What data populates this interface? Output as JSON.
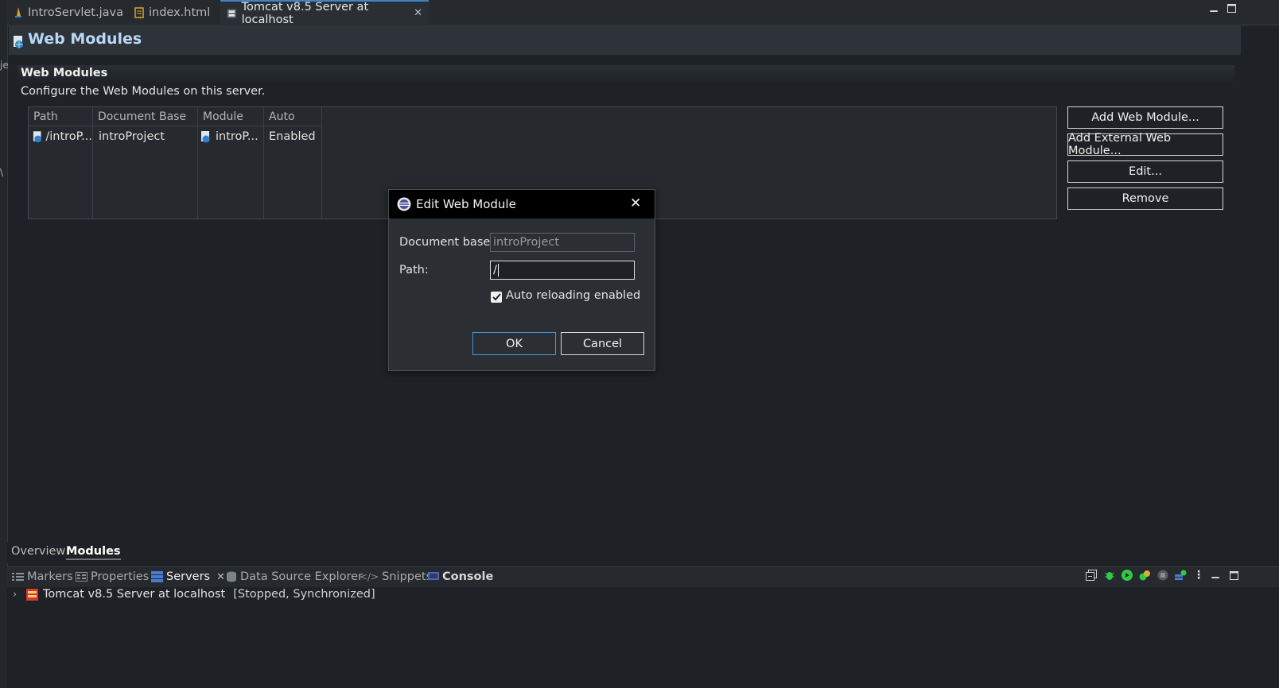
{
  "gutter": {
    "char1": "je",
    "char2": "\\"
  },
  "editor_tabs": [
    {
      "label": "IntroServlet.java",
      "icon": "java-file-icon"
    },
    {
      "label": "index.html",
      "icon": "html-file-icon"
    },
    {
      "label": "Tomcat v8.5 Server at localhost",
      "icon": "server-editor-icon",
      "active": true
    }
  ],
  "form": {
    "title": "Web Modules",
    "section_title": "Web Modules",
    "section_description": "Configure the Web Modules on this server.",
    "table": {
      "columns": [
        "Path",
        "Document Base",
        "Module",
        "Auto Relo"
      ],
      "rows": [
        {
          "path": "/introP...",
          "document_base": "introProject",
          "module": "introP...",
          "auto_reload": "Enabled"
        }
      ]
    },
    "buttons": {
      "add": "Add Web Module...",
      "add_external": "Add External Web Module...",
      "edit": "Edit...",
      "remove": "Remove"
    },
    "page_tabs": [
      {
        "label": "Overview",
        "active": false
      },
      {
        "label": "Modules",
        "active": true
      }
    ]
  },
  "views": {
    "tabs": [
      {
        "label": "Markers",
        "icon": "markers-icon"
      },
      {
        "label": "Properties",
        "icon": "properties-icon"
      },
      {
        "label": "Servers",
        "icon": "servers-icon",
        "active": true
      },
      {
        "label": "Data Source Explorer",
        "icon": "data-source-icon"
      },
      {
        "label": "Snippets",
        "icon": "snippets-icon"
      },
      {
        "label": "Console",
        "icon": "console-icon"
      }
    ],
    "server_entry": {
      "name": "Tomcat v8.5 Server at localhost",
      "status": "[Stopped, Synchronized]"
    }
  },
  "dialog": {
    "title": "Edit Web Module",
    "document_base_label": "Document base:",
    "document_base_value": "introProject",
    "path_label": "Path:",
    "path_value": "/",
    "auto_reload_label": "Auto reloading enabled",
    "auto_reload_checked": true,
    "ok": "OK",
    "cancel": "Cancel"
  },
  "colors": {
    "accent_blue": "#3e97e0",
    "title_blue": "#b8d8f5",
    "run_green": "#2ecc40"
  }
}
